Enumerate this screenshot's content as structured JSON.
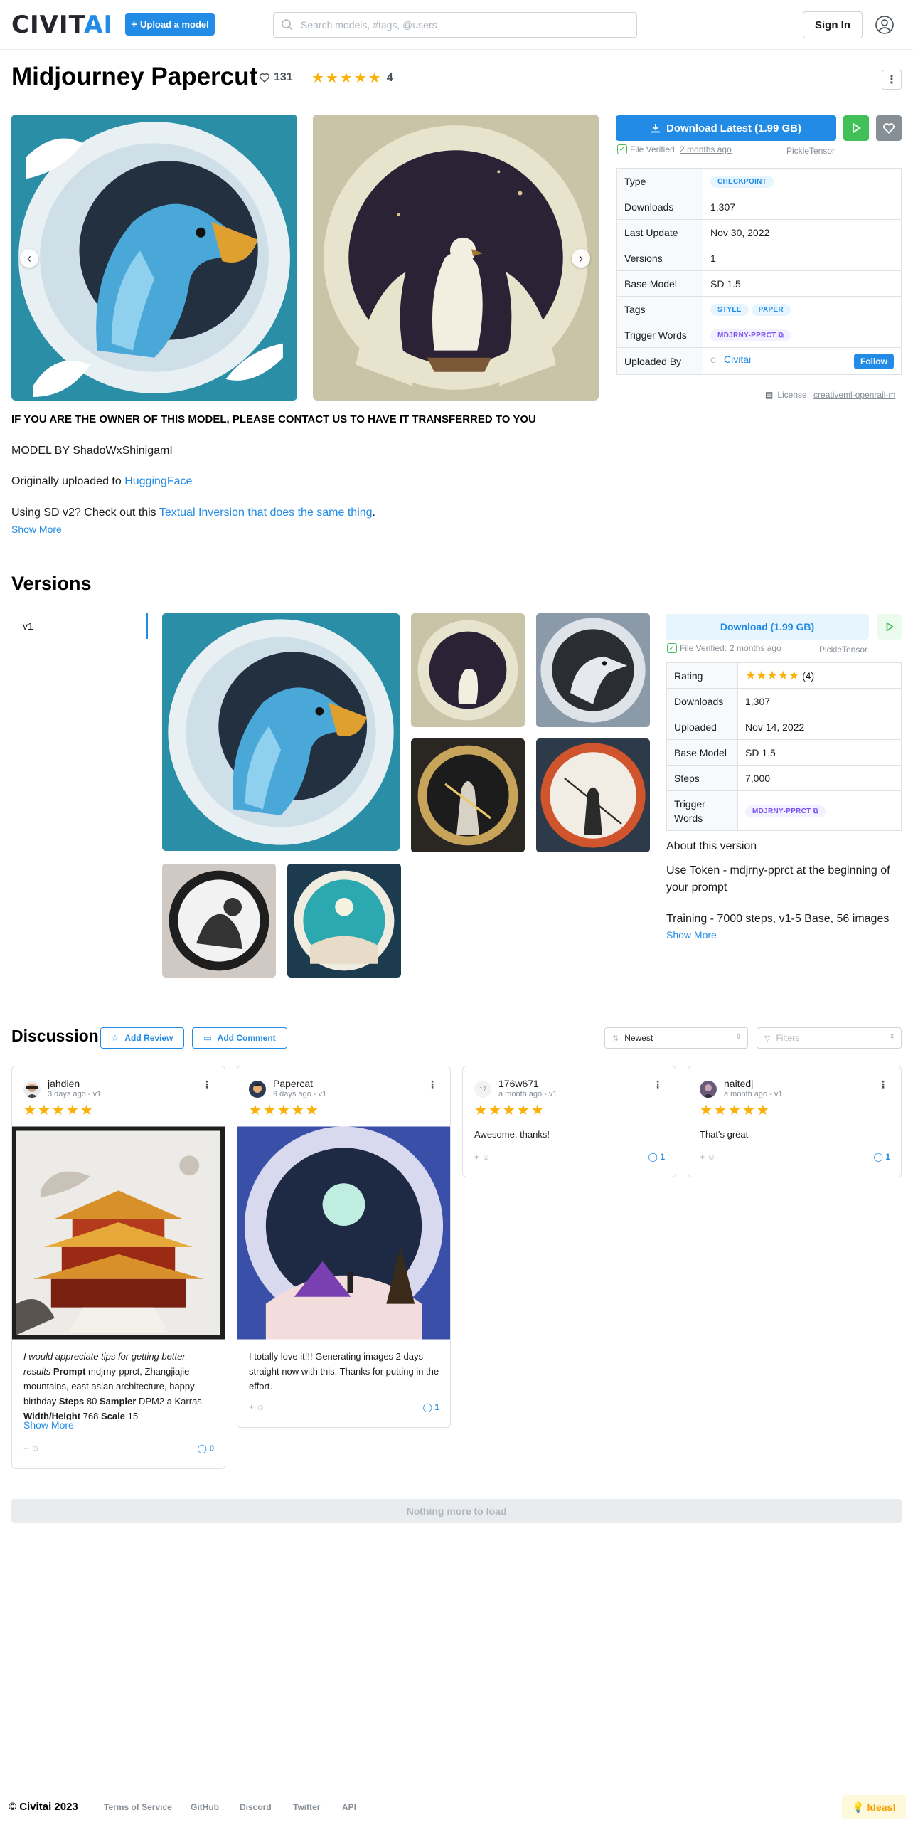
{
  "header": {
    "logo_main": "CIVIT",
    "logo_accent": "AI",
    "upload_label": "Upload a model",
    "search_placeholder": "Search models, #tags, @users",
    "signin_label": "Sign In"
  },
  "model": {
    "title": "Midjourney Papercut",
    "likes": "131",
    "rating_count": "4",
    "download_label": "Download Latest (1.99 GB)",
    "verified_text": "File Verified:",
    "verified_when": "2 months ago",
    "scanner": "PickleTensor",
    "info": {
      "type_k": "Type",
      "type_v": "CHECKPOINT",
      "downloads_k": "Downloads",
      "downloads_v": "1,307",
      "update_k": "Last Update",
      "update_v": "Nov 30, 2022",
      "versions_k": "Versions",
      "versions_v": "1",
      "base_k": "Base Model",
      "base_v": "SD 1.5",
      "tags_k": "Tags",
      "tag1": "STYLE",
      "tag2": "PAPER",
      "trigger_k": "Trigger Words",
      "trigger_v": "MDJRNY-PPRCT",
      "uploaded_k": "Uploaded By",
      "uploaded_v": "Civitai",
      "follow": "Follow"
    },
    "license_label": "License:",
    "license_value": "creativeml-openrail-m"
  },
  "description": {
    "heading": "IF YOU ARE THE OWNER OF THIS MODEL, PLEASE CONTACT US TO HAVE IT TRANSFERRED TO YOU",
    "line1": "MODEL BY ShadoWxShinigamI",
    "line2_prefix": "Originally uploaded to ",
    "line2_link": "HuggingFace",
    "line3_prefix": "Using SD v2? Check out this ",
    "line3_link": "Textual Inversion that does the same thing",
    "line3_suffix": ".",
    "show_more": "Show More"
  },
  "versions": {
    "title": "Versions",
    "tab": "v1",
    "download_label": "Download (1.99 GB)",
    "verified_text": "File Verified:",
    "verified_when": "2 months ago",
    "scanner": "PickleTensor",
    "info": {
      "rating_k": "Rating",
      "rating_v": "(4)",
      "downloads_k": "Downloads",
      "downloads_v": "1,307",
      "uploaded_k": "Uploaded",
      "uploaded_v": "Nov 14, 2022",
      "base_k": "Base Model",
      "base_v": "SD 1.5",
      "steps_k": "Steps",
      "steps_v": "7,000",
      "trigger_k": "Trigger Words",
      "trigger_v": "MDJRNY-PPRCT"
    },
    "about_heading": "About this version",
    "about_p1": "Use Token - mdjrny-pprct at the beginning of your prompt",
    "about_p2": "Training - 7000 steps, v1-5 Base, 56 images",
    "show_more": "Show More"
  },
  "discussion": {
    "title": "Discussion",
    "add_review": "Add Review",
    "add_comment": "Add Comment",
    "sort_value": "Newest",
    "filters_placeholder": "Filters",
    "cards": [
      {
        "name": "jahdien",
        "time": "3 days ago - v1",
        "count": "0",
        "t1": "I would appreciate tips for getting better results",
        "t2": "Prompt",
        "t3": "mdjrny-pprct, Zhangjiajie mountains, east asian architecture, happy birthday",
        "t4": "Steps",
        "t5": "80",
        "t6": "Sampler",
        "t7": "DPM2 a Karras",
        "t8": "Width/Height",
        "t9": "768",
        "t10": "Scale",
        "t11": "15",
        "more": "Show More"
      },
      {
        "name": "Papercat",
        "time": "9 days ago - v1",
        "count": "1",
        "text": "I totally love it!!! Generating images 2 days straight now with this. Thanks for putting in the effort."
      },
      {
        "name": "176w671",
        "time": "a month ago - v1",
        "count": "1",
        "avatar_text": "17",
        "text": "Awesome, thanks!"
      },
      {
        "name": "naitedj",
        "time": "a month ago - v1",
        "count": "1",
        "text": "That's great"
      }
    ],
    "no_more": "Nothing more to load"
  },
  "footer": {
    "copyright": "© Civitai 2023",
    "links": [
      "Terms of Service",
      "GitHub",
      "Discord",
      "Twitter",
      "API"
    ],
    "ideas": "Ideas!"
  },
  "colors": {
    "accent": "#228be6",
    "star": "#fab005",
    "success": "#40c057"
  }
}
